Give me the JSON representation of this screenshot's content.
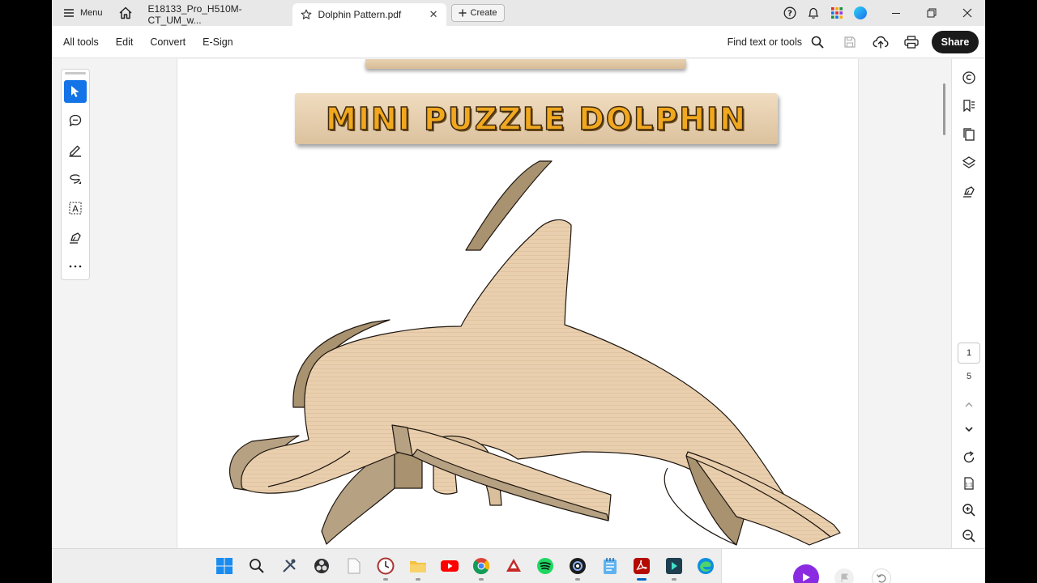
{
  "tabbar": {
    "menu_label": "Menu",
    "tabs": [
      {
        "label": "E18133_Pro_H510M-CT_UM_w..."
      },
      {
        "label": "Dolphin Pattern.pdf"
      }
    ],
    "create_label": "Create"
  },
  "toolbar": {
    "items": [
      "All tools",
      "Edit",
      "Convert",
      "E-Sign"
    ],
    "find_label": "Find text or tools",
    "share_label": "Share"
  },
  "document": {
    "banner_title": "MINI PUZZLE DOLPHIN"
  },
  "navigation": {
    "current_page": "1",
    "total_pages": "5"
  },
  "colors": {
    "accent": "#1473e6",
    "banner_text": "#f1a81f",
    "wood": "#e9cfae",
    "wood_edge": "#b49c7e"
  }
}
